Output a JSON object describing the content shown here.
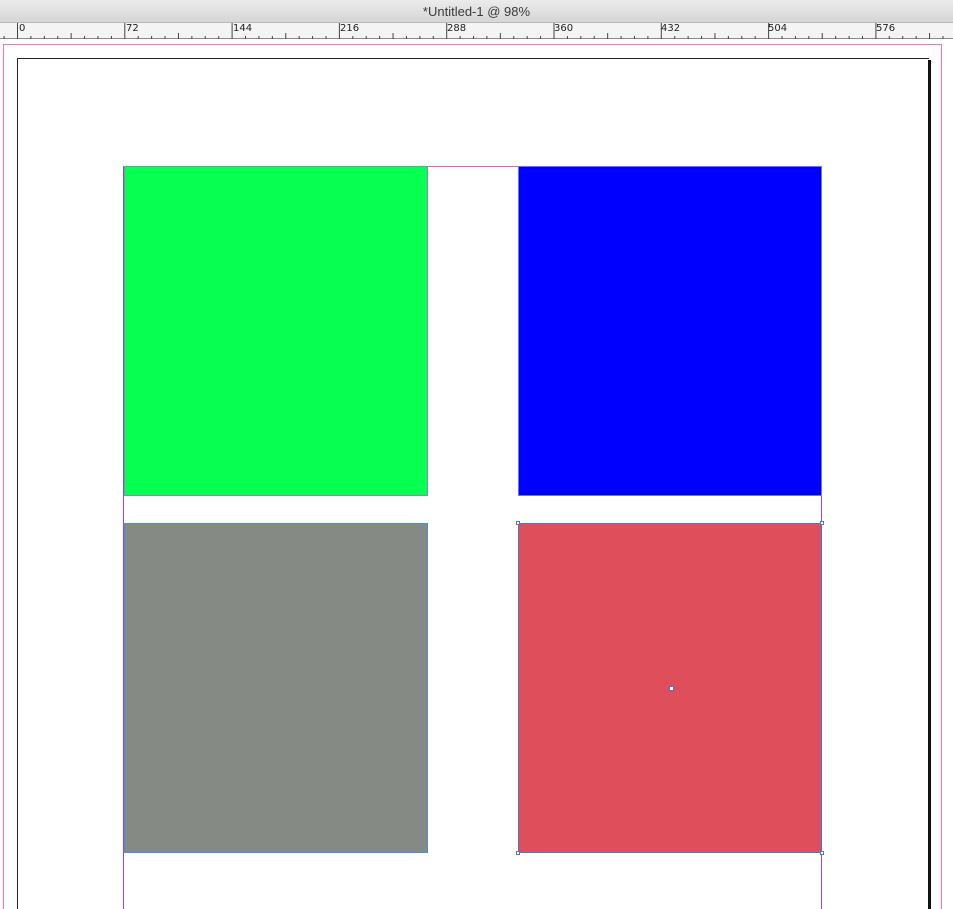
{
  "window": {
    "title": "*Untitled-1 @ 98%"
  },
  "ruler": {
    "labels": [
      "0",
      "72",
      "144",
      "216",
      "288",
      "360",
      "432",
      "504",
      "576"
    ]
  },
  "document": {
    "zoom": "98%",
    "rectangles": [
      {
        "name": "green",
        "fill": "#07FF52"
      },
      {
        "name": "blue",
        "fill": "#0000FF"
      },
      {
        "name": "gray",
        "fill": "#868A84"
      },
      {
        "name": "red",
        "fill": "#DE4F5B",
        "selected": true
      }
    ]
  },
  "colors": {
    "guide_margin": "#9A44E8",
    "guide_bleed": "#F07AA0",
    "selection": "#4A78D0"
  }
}
